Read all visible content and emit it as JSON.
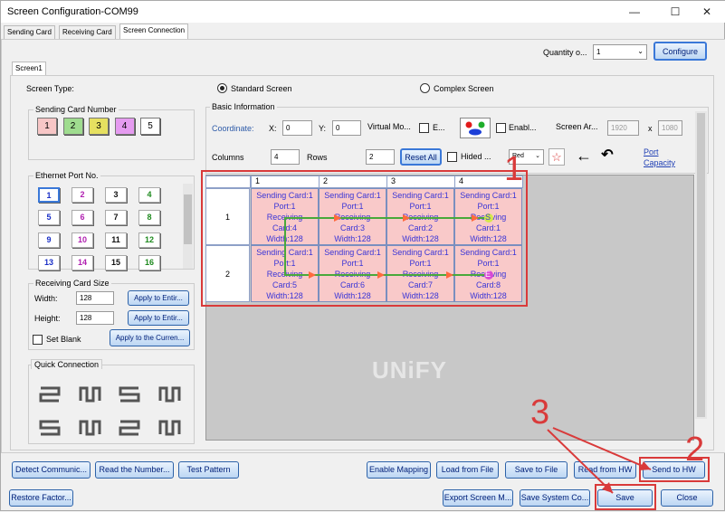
{
  "window": {
    "title": "Screen Configuration-COM99",
    "minimize": "—",
    "maximize": "☐",
    "close": "✕"
  },
  "tabs": [
    {
      "label": "Sending Card"
    },
    {
      "label": "Receiving Card"
    },
    {
      "label": "Screen Connection"
    }
  ],
  "top": {
    "quantity_label": "Quantity o...",
    "quantity_value": "1",
    "configure": "Configure",
    "screen_tab": "Screen1"
  },
  "screen_type": {
    "label": "Screen Type:",
    "standard": "Standard Screen",
    "complex": "Complex Screen"
  },
  "sending_card": {
    "title": "Sending Card Number",
    "items": [
      "1",
      "2",
      "3",
      "4",
      "5"
    ],
    "colors": [
      "#f7c6c6",
      "#9fdc8f",
      "#e6e060",
      "#e59bf0",
      "#ffffff"
    ]
  },
  "ethernet": {
    "title": "Ethernet Port No.",
    "items": [
      "1",
      "2",
      "3",
      "4",
      "5",
      "6",
      "7",
      "8",
      "9",
      "10",
      "11",
      "12",
      "13",
      "14",
      "15",
      "16"
    ],
    "colors": [
      "#1a2fc7",
      "#b01fb0",
      "#111",
      "#1e8a1e",
      "#1a2fc7",
      "#b01fb0",
      "#111",
      "#1e8a1e",
      "#1a2fc7",
      "#b01fb0",
      "#111",
      "#1e8a1e",
      "#1a2fc7",
      "#b01fb0",
      "#111",
      "#1e8a1e"
    ]
  },
  "rc_size": {
    "title": "Receiving Card Size",
    "width_label": "Width:",
    "width": "128",
    "height_label": "Height:",
    "height": "128",
    "apply_entire": "Apply to Entir...",
    "set_blank": "Set Blank",
    "apply_current": "Apply to the Curren..."
  },
  "quick": {
    "title": "Quick Connection"
  },
  "basic": {
    "title": "Basic Information",
    "coordinate": "Coordinate:",
    "x_label": "X:",
    "x": "0",
    "y_label": "Y:",
    "y": "0",
    "virtual": "Virtual Mo...",
    "e": "E...",
    "enable": "Enabl...",
    "screen_area": "Screen Ar...",
    "area_w": "1920",
    "x_sep": "x",
    "area_h": "1080",
    "columns_label": "Columns",
    "columns": "4",
    "rows_label": "Rows",
    "rows": "2",
    "reset": "Reset All",
    "hided": "Hided ...",
    "red_select": "Red",
    "port_capacity_1": "Port",
    "port_capacity_2": "Capacity"
  },
  "grid": {
    "col_headers": [
      "1",
      "2",
      "3",
      "4"
    ],
    "row_headers": [
      "1",
      "2"
    ],
    "cells": [
      [
        "Sending Card:1",
        "Port:1",
        "Receiving",
        "Card:4",
        "Width:128"
      ],
      [
        "Sending Card:1",
        "Port:1",
        "Receiving",
        "Card:3",
        "Width:128"
      ],
      [
        "Sending Card:1",
        "Port:1",
        "Receiving",
        "Card:2",
        "Width:128"
      ],
      [
        "Sending Card:1",
        "Port:1",
        "Receiving",
        "Card:1",
        "Width:128"
      ],
      [
        "Sending Card:1",
        "Port:1",
        "Receiving",
        "Card:5",
        "Width:128"
      ],
      [
        "Sending Card:1",
        "Port:1",
        "Receiving",
        "Card:6",
        "Width:128"
      ],
      [
        "Sending Card:1",
        "Port:1",
        "Receiving",
        "Card:7",
        "Width:128"
      ],
      [
        "Sending Card:1",
        "Port:1",
        "Receiving",
        "Card:8",
        "Width:128"
      ]
    ],
    "watermark": "UNiFY",
    "start_marker": "S",
    "end_marker": "E"
  },
  "bottom": {
    "detect": "Detect Communic...",
    "read_number": "Read the Number...",
    "test_pattern": "Test Pattern",
    "enable_mapping": "Enable Mapping",
    "load_file": "Load from File",
    "save_file": "Save to File",
    "read_hw": "Read from HW",
    "send_hw": "Send to HW",
    "restore": "Restore Factor...",
    "export": "Export Screen M...",
    "save_system": "Save System Co...",
    "save": "Save",
    "close": "Close"
  },
  "annotations": [
    "1",
    "2",
    "3"
  ],
  "accent": "#d93a3a"
}
